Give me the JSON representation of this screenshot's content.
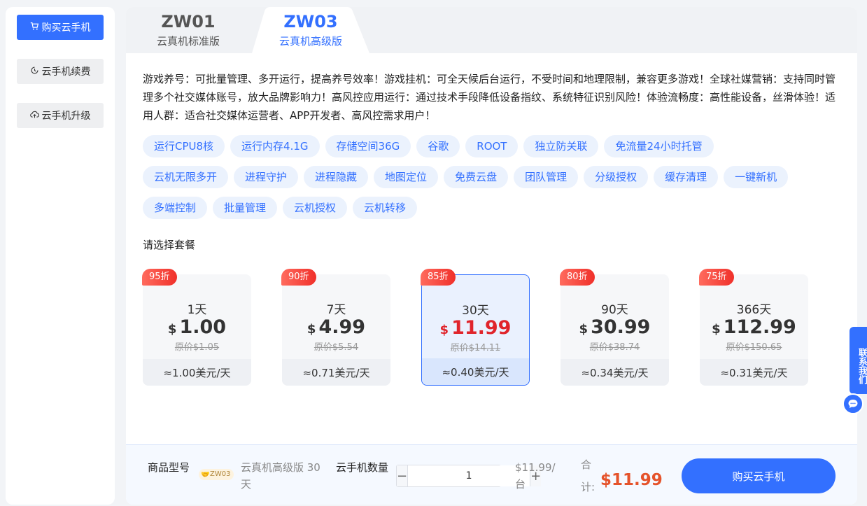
{
  "sidebar": {
    "buy_label": "购买云手机",
    "renew_label": "云手机续费",
    "upgrade_label": "云手机升级"
  },
  "tabs": [
    {
      "code": "ZW01",
      "name": "云真机标准版"
    },
    {
      "code": "ZW03",
      "name": "云真机高级版"
    }
  ],
  "description": "游戏养号：可批量管理、多开运行，提高养号效率！游戏挂机：可全天候后台运行，不受时间和地理限制，兼容更多游戏！全球社媒营销：支持同时管理多个社交媒体账号，放大品牌影响力！高风控应用运行：通过技术手段降低设备指纹、系统特征识别风险！体验流畅度：高性能设备，丝滑体验！适用人群：适合社交媒体运营者、APP开发者、高风控需求用户！",
  "tags": [
    "运行CPU8核",
    "运行内存4.1G",
    "存储空间36G",
    "谷歌",
    "ROOT",
    "独立防关联",
    "免流量24小时托管",
    "云机无限多开",
    "进程守护",
    "进程隐藏",
    "地图定位",
    "免费云盘",
    "团队管理",
    "分级授权",
    "缓存清理",
    "一键新机",
    "多端控制",
    "批量管理",
    "云机授权",
    "云机转移"
  ],
  "plan_title": "请选择套餐",
  "plans": [
    {
      "badge": "95折",
      "days": "1天",
      "currency": "$",
      "price": "1.00",
      "original": "原价$1.05",
      "per_day": "≈1.00美元/天"
    },
    {
      "badge": "90折",
      "days": "7天",
      "currency": "$",
      "price": "4.99",
      "original": "原价$5.54",
      "per_day": "≈0.71美元/天"
    },
    {
      "badge": "85折",
      "days": "30天",
      "currency": "$",
      "price": "11.99",
      "original": "原价$14.11",
      "per_day": "≈0.40美元/天",
      "selected": true
    },
    {
      "badge": "80折",
      "days": "90天",
      "currency": "$",
      "price": "30.99",
      "original": "原价$38.74",
      "per_day": "≈0.34美元/天"
    },
    {
      "badge": "75折",
      "days": "366天",
      "currency": "$",
      "price": "112.99",
      "original": "原价$150.65",
      "per_day": "≈0.31美元/天"
    }
  ],
  "bottom": {
    "model_label": "商品型号",
    "model_badge": "ZW03",
    "model_value": "云真机高级版 30天",
    "qty_label": "云手机数量",
    "qty_value": "1",
    "minus": "−",
    "plus": "+",
    "unit_price": "$11.99/台",
    "total_label": "合计:",
    "total_amount": "$11.99",
    "buy_label": "购买云手机"
  },
  "contact_label": "联系我们",
  "colors": {
    "accent": "#3370ff",
    "discount": "#f0302a",
    "total": "#e5532b",
    "selected_price": "#e0242b"
  }
}
